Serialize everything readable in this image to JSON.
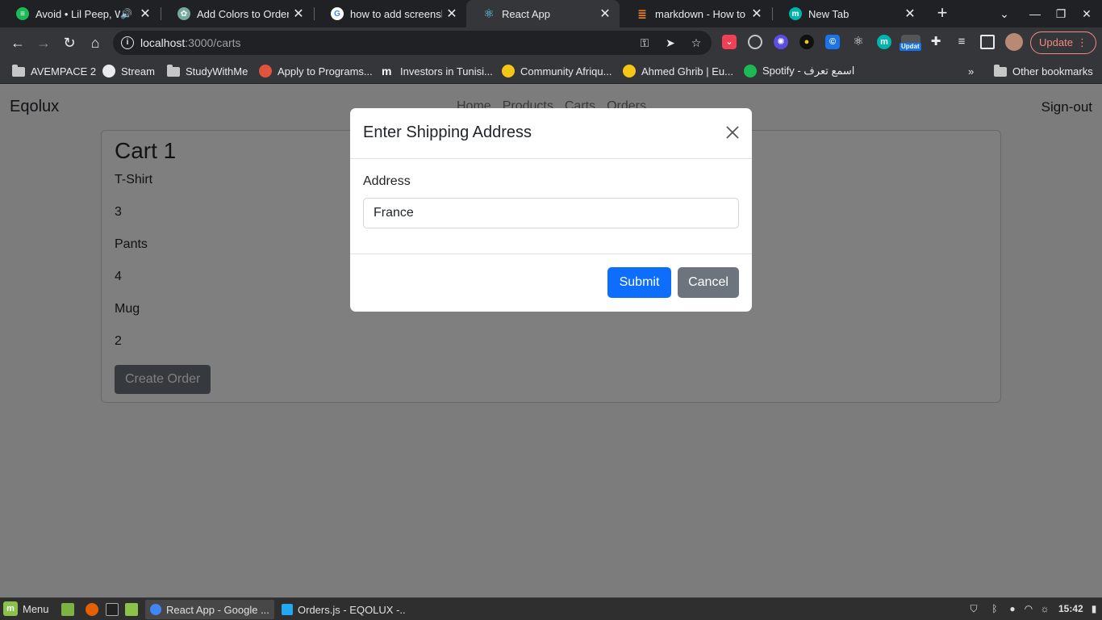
{
  "browser": {
    "tabs": [
      {
        "title": "Avoid • Lil Peep, W",
        "icon": "spotify-icon",
        "color": "#1db954",
        "audio": true,
        "active": false
      },
      {
        "title": "Add Colors to Orders",
        "icon": "chatgpt-icon",
        "color": "#74aa9c",
        "active": false
      },
      {
        "title": "how to add screensho",
        "icon": "google-icon",
        "color": "#ffffff",
        "active": false
      },
      {
        "title": "React App",
        "icon": "react-icon",
        "color": "#61dafb",
        "active": true
      },
      {
        "title": "markdown - How to ad",
        "icon": "stackoverflow-icon",
        "color": "#f48024",
        "active": false
      },
      {
        "title": "New Tab",
        "icon": "m-icon",
        "color": "#00b5ad",
        "active": false
      }
    ],
    "address": {
      "host": "localhost",
      "path": ":3000/carts"
    },
    "update_label": "Update",
    "extension_badge": "Updat",
    "bookmarks": [
      {
        "label": "AVEMPACE 2",
        "icon": "folder-icon"
      },
      {
        "label": "Stream",
        "icon": "globe-icon"
      },
      {
        "label": "StudyWithMe",
        "icon": "folder-icon"
      },
      {
        "label": "Apply to Programs...",
        "icon": "site-icon"
      },
      {
        "label": "Investors in Tunisi...",
        "icon": "m-logo-icon"
      },
      {
        "label": "Community Afriqu...",
        "icon": "site-icon"
      },
      {
        "label": "Ahmed Ghrib | Eu...",
        "icon": "site-icon"
      },
      {
        "label": "Spotify - اسمع تعرف",
        "icon": "spotify-icon"
      }
    ],
    "other_bookmarks": "Other bookmarks",
    "more": "»"
  },
  "app": {
    "brand": "Eqolux",
    "nav": [
      "Home",
      "Products",
      "Carts",
      "Orders"
    ],
    "signout": "Sign-out",
    "cart": {
      "title": "Cart 1",
      "items": [
        "T-Shirt",
        "3",
        "Pants",
        "4",
        "Mug",
        "2"
      ],
      "create_order": "Create Order"
    }
  },
  "modal": {
    "title": "Enter Shipping Address",
    "label": "Address",
    "value": "France",
    "submit": "Submit",
    "cancel": "Cancel"
  },
  "taskbar": {
    "menu": "Menu",
    "windows": [
      {
        "title": "React App - Google ...",
        "active": true
      },
      {
        "title": "Orders.js - EQOLUX -...",
        "active": false
      }
    ],
    "clock": "15:42"
  }
}
